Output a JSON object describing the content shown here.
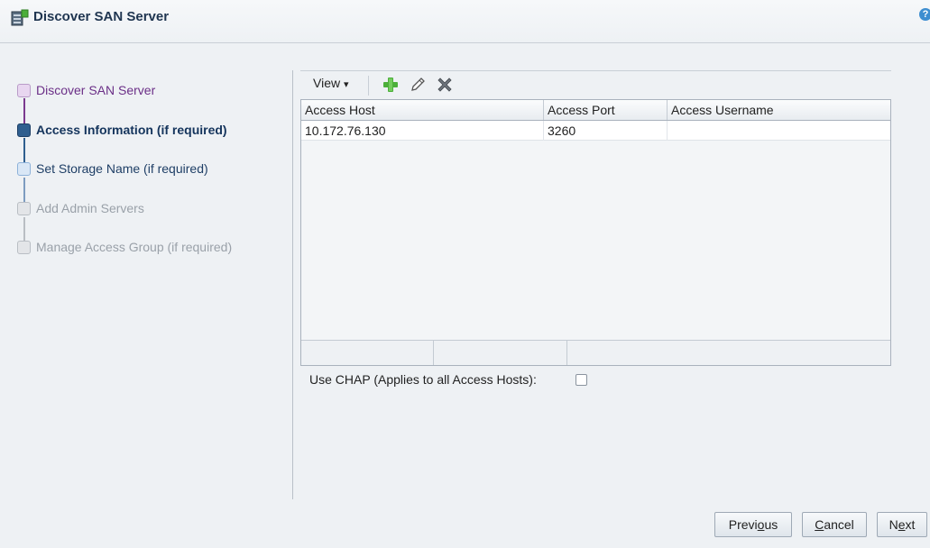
{
  "window": {
    "title": "Discover SAN Server",
    "help_label": "?"
  },
  "train": {
    "steps": [
      {
        "label": "Discover SAN Server",
        "state": "visited"
      },
      {
        "label": "Access Information (if required)",
        "state": "current"
      },
      {
        "label": "Set Storage Name (if required)",
        "state": "next"
      },
      {
        "label": "Add Admin Servers",
        "state": "disabled"
      },
      {
        "label": "Manage Access Group (if required)",
        "state": "disabled"
      }
    ]
  },
  "toolbar": {
    "view_label": "View",
    "view_arrow": "▾",
    "icons": [
      "add-icon",
      "edit-icon",
      "delete-icon"
    ]
  },
  "table": {
    "columns": [
      "Access Host",
      "Access Port",
      "Access Username"
    ],
    "rows": [
      [
        "10.172.76.130",
        "3260",
        ""
      ]
    ]
  },
  "chap": {
    "label": "Use CHAP (Applies to all Access Hosts):",
    "checked": false
  },
  "buttons": {
    "previous": {
      "pre": "Previ",
      "u": "o",
      "post": "us"
    },
    "cancel": {
      "pre": "",
      "u": "C",
      "post": "ancel"
    },
    "next": {
      "pre": "N",
      "u": "e",
      "post": "xt"
    }
  },
  "colors": {
    "accent": "#2f5f8f",
    "visited": "#6b2f87",
    "add_green": "#4caf3a"
  }
}
